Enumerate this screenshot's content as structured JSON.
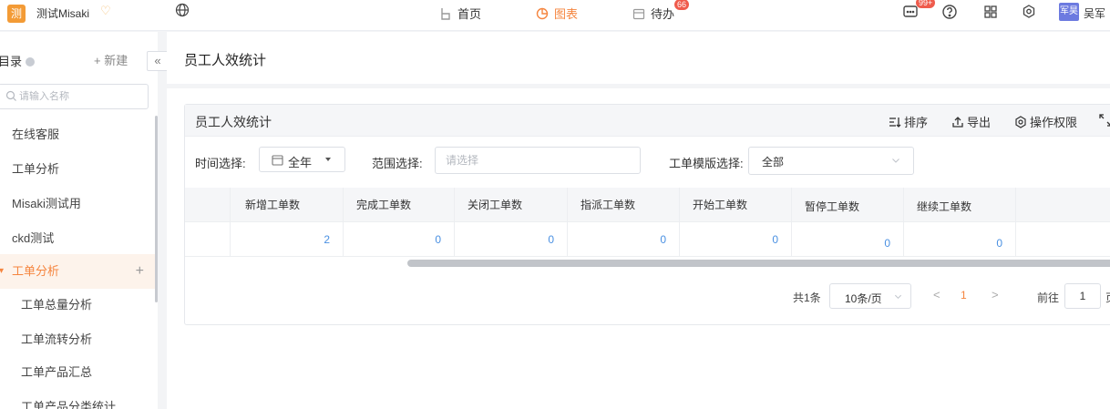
{
  "app": {
    "logo_char": "测",
    "name": "测试Misaki"
  },
  "nav": {
    "home": "首页",
    "chart": "图表",
    "todo": "待办",
    "todo_badge": "66",
    "msg_badge": "99+"
  },
  "user": {
    "tag": "军昊",
    "name": "吴军"
  },
  "sidebar": {
    "title": "目录",
    "new_label": "+ 新建",
    "collapse": "«",
    "search_placeholder": "请输入名称",
    "items": [
      {
        "label": "在线客服"
      },
      {
        "label": "工单分析"
      },
      {
        "label": "Misaki测试用"
      },
      {
        "label": "ckd测试"
      },
      {
        "label": "工单分析",
        "active": true
      },
      {
        "label": "工单总量分析"
      },
      {
        "label": "工单流转分析"
      },
      {
        "label": "工单产品汇总"
      },
      {
        "label": "工单产品分类统计"
      }
    ]
  },
  "page": {
    "title": "员工人效统计"
  },
  "panel": {
    "title": "员工人效统计",
    "toolbar": {
      "sort": "排序",
      "export": "导出",
      "permission": "操作权限"
    }
  },
  "filters": {
    "time_label": "时间选择:",
    "time_value": "全年",
    "scope_label": "范围选择:",
    "scope_placeholder": "请选择",
    "template_label": "工单模版选择:",
    "template_value": "全部"
  },
  "table": {
    "columns": [
      "新增工单数",
      "完成工单数",
      "关闭工单数",
      "指派工单数",
      "开始工单数",
      "暂停工单数",
      "继续工单数"
    ],
    "rows": [
      [
        "2",
        "0",
        "0",
        "0",
        "0",
        "0",
        "0"
      ]
    ]
  },
  "pagination": {
    "total": "共1条",
    "page_size": "10条/页",
    "prev": "<",
    "next": ">",
    "current": "1",
    "goto_label": "前往",
    "goto_value": "1",
    "goto_suffix": "页"
  },
  "colors": {
    "accent": "#f5853f",
    "link": "#4a90e2",
    "badge": "#ef5b4c",
    "user_tag": "#6c7ae0"
  }
}
